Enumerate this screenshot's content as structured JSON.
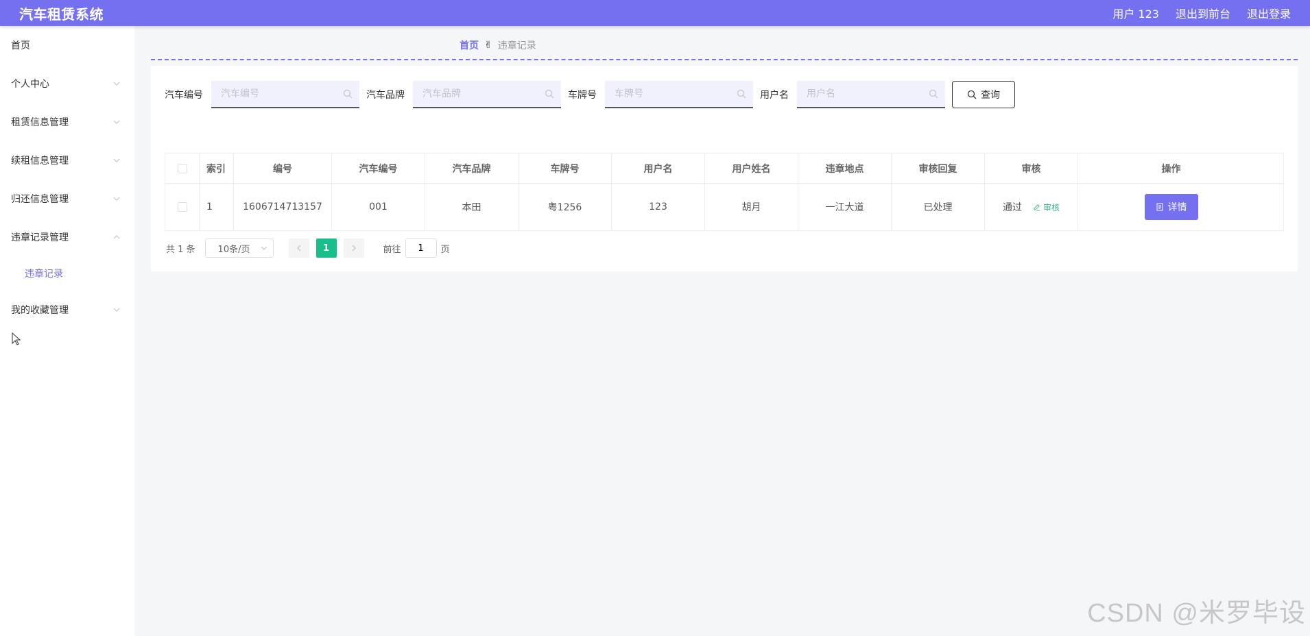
{
  "header": {
    "app_title": "汽车租赁系统",
    "user_label": "用户 123",
    "to_frontend": "退出到前台",
    "logout": "退出登录"
  },
  "sidebar": {
    "items": [
      {
        "label": "首页",
        "chevron": "none"
      },
      {
        "label": "个人中心",
        "chevron": "down"
      },
      {
        "label": "租赁信息管理",
        "chevron": "down"
      },
      {
        "label": "续租信息管理",
        "chevron": "down"
      },
      {
        "label": "归还信息管理",
        "chevron": "down"
      },
      {
        "label": "违章记录管理",
        "chevron": "up"
      },
      {
        "label": "违章记录",
        "sub": true
      },
      {
        "label": "我的收藏管理",
        "chevron": "down"
      }
    ]
  },
  "breadcrumb": {
    "home": "首页",
    "current": "违章记录"
  },
  "search": {
    "car_no_label": "汽车编号",
    "car_no_placeholder": "汽车编号",
    "brand_label": "汽车品牌",
    "brand_placeholder": "汽车品牌",
    "plate_label": "车牌号",
    "plate_placeholder": "车牌号",
    "username_label": "用户名",
    "username_placeholder": "用户名",
    "query_button": "查询"
  },
  "table": {
    "headers": [
      "索引",
      "编号",
      "汽车编号",
      "汽车品牌",
      "车牌号",
      "用户名",
      "用户姓名",
      "违章地点",
      "审核回复",
      "审核",
      "操作"
    ],
    "rows": [
      {
        "index": "1",
        "no": "1606714713157",
        "car_no": "001",
        "brand": "本田",
        "plate": "粤1256",
        "username": "123",
        "real_name": "胡月",
        "location": "一江大道",
        "reply": "已处理",
        "status": "通过",
        "review_link": "审核",
        "detail_button": "详情"
      }
    ]
  },
  "pagination": {
    "total": "共 1 条",
    "page_size": "10条/页",
    "current_page": "1",
    "goto_label": "前往",
    "goto_value": "1",
    "page_suffix": "页"
  },
  "watermark": "CSDN @米罗毕设",
  "colors": {
    "accent": "#7570f0",
    "page_active": "#19be8c",
    "review_link": "#3bb48a"
  }
}
